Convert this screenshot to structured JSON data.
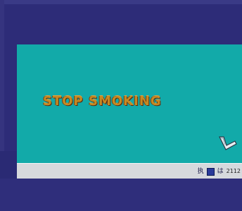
{
  "desktop": {
    "banner_text": "STOP SMOKING",
    "background_color": "#12aaa9",
    "shortcut_icon": "shortcut-arrow-icon"
  },
  "taskbar": {
    "tray_glyph_1": "执",
    "tray_icon": "network-icon",
    "tray_glyph_2": "は",
    "clock_text": "2112"
  },
  "colors": {
    "frame": "#2d2c78",
    "taskbar": "#d6d9dd",
    "banner": "#c58a22"
  }
}
